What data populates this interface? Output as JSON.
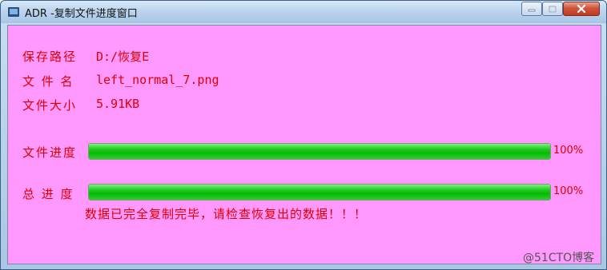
{
  "window": {
    "title": "ADR -复制文件进度窗口"
  },
  "fields": {
    "save_path_label": "保存路径",
    "save_path_value": "D:/恢复E",
    "filename_label": "文 件 名",
    "filename_value": "left_normal_7.png",
    "filesize_label": "文件大小",
    "filesize_value": "5.91KB"
  },
  "progress": {
    "file_label": "文件进度",
    "file_value": 100,
    "file_pct_text": "100%",
    "total_label": "总 进 度",
    "total_value": 100,
    "total_pct_text": "100%"
  },
  "message": "数据已完全复制完毕，请检查恢复出的数据！！！",
  "watermark": "@51CTO博客",
  "colors": {
    "background": "#ff99ff",
    "text": "#e00000",
    "progress_fill": "#06b806"
  }
}
